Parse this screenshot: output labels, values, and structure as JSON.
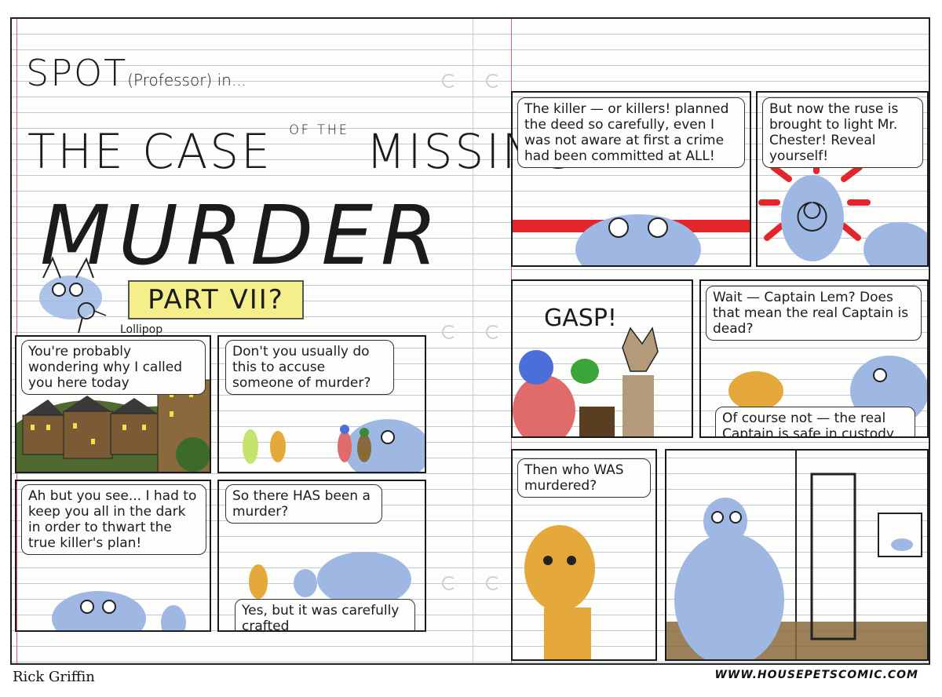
{
  "title": {
    "spot": "SPOT",
    "professor": "(Professor)",
    "in": " in...",
    "the_case": "THE CASE",
    "of_the": "OF THE",
    "missing": "MISSING",
    "murder": "MURDER",
    "part": "PART VII?",
    "lollipop_label": "Lollipop"
  },
  "panels": {
    "p1": "You're probably wondering why I called you here today",
    "p2": "Don't you usually do this to accuse someone of murder?",
    "p3": "Ah but you see... I had to keep you all in the dark in order to thwart the true killer's plan!",
    "p4a": "So there HAS been a murder?",
    "p4b": "Yes, but it was carefully crafted",
    "p5": "The killer — or killers! planned the deed so carefully, even I was not aware at first a crime had been committed at ALL!",
    "p6": "But now the ruse is brought to light Mr. Chester! Reveal yourself!",
    "p7": "GASP!",
    "p8a": "Wait — Captain Lem? Does that mean the real Captain is dead?",
    "p8b": "Of course not — the real Captain is safe in custody",
    "p9": "Then who WAS murdered?"
  },
  "footer": {
    "author": "Rick Griffin",
    "url": "WWW.HOUSEPETSCOMIC.COM"
  },
  "colors": {
    "spot_blue": "#9fb8e3",
    "yellow_highlight": "#f4ef8a",
    "red_laser": "#e3262c",
    "dog_orange": "#e5a83a",
    "brown": "#8a6a3c",
    "green_grass": "#4f6a2e",
    "paper_line": "#b9c9d8",
    "margin_red": "#e45a78"
  }
}
